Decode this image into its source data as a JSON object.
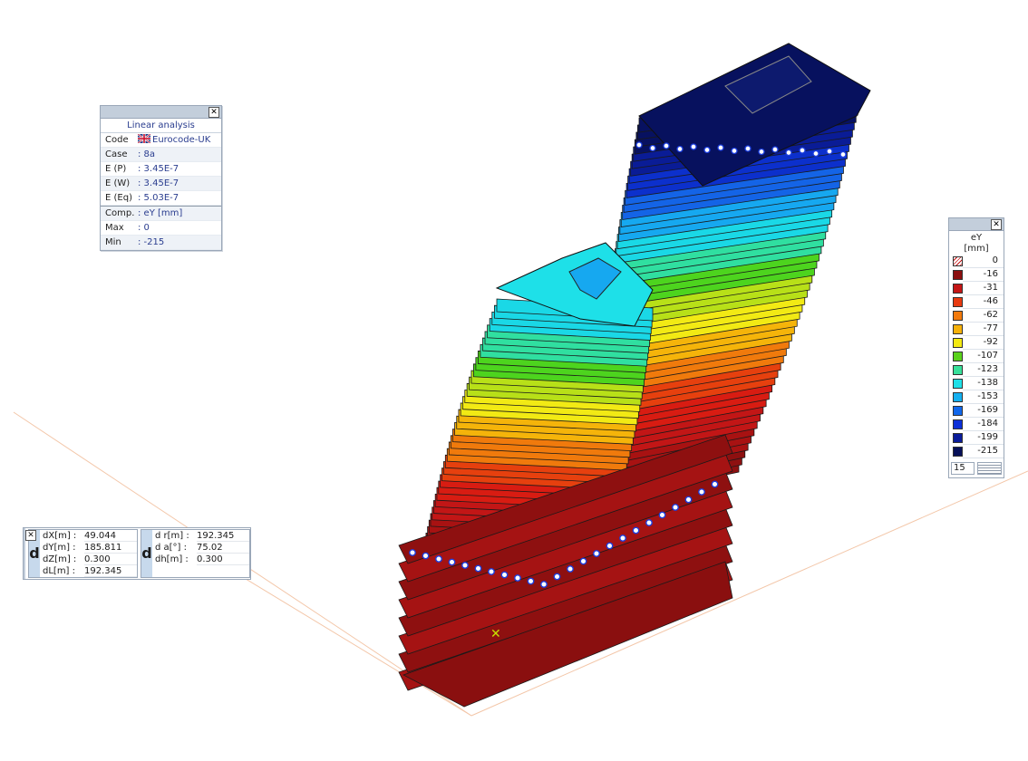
{
  "info_panel": {
    "close_label": "✕",
    "heading": "Linear analysis",
    "rows": [
      {
        "key": "Code",
        "value": "Eurocode-UK"
      },
      {
        "key": "Case",
        "value": ": 8a"
      },
      {
        "key": "E (P)",
        "value": ": 3.45E-7"
      },
      {
        "key": "E (W)",
        "value": ": 3.45E-7"
      },
      {
        "key": "E (Eq)",
        "value": ": 5.03E-7"
      },
      {
        "key": "Comp.",
        "value": ": eY [mm]"
      },
      {
        "key": "Max",
        "value": ": 0"
      },
      {
        "key": "Min",
        "value": ": -215"
      }
    ]
  },
  "legend": {
    "close_label": "✕",
    "title_line1": "eY",
    "title_line2": "[mm]",
    "values": [
      "0",
      "-16",
      "-31",
      "-46",
      "-62",
      "-77",
      "-92",
      "-107",
      "-123",
      "-138",
      "-153",
      "-169",
      "-184",
      "-199",
      "-215"
    ],
    "colors": [
      "#ffffff",
      "#8b0f0f",
      "#c41616",
      "#e83a10",
      "#f27a0c",
      "#f6b10a",
      "#f4ea12",
      "#5ad21c",
      "#38e09a",
      "#1ee0e8",
      "#14b0f0",
      "#1267ea",
      "#0c2fd8",
      "#0a1c9a",
      "#071058"
    ],
    "count": "15"
  },
  "measure": {
    "close_label": "✕",
    "d_label": "d",
    "left": [
      {
        "key": "dX[m] :",
        "value": "49.044"
      },
      {
        "key": "dY[m] :",
        "value": "185.811"
      },
      {
        "key": "dZ[m] :",
        "value": "0.300"
      },
      {
        "key": "dL[m] :",
        "value": "192.345"
      }
    ],
    "right": [
      {
        "key": "d r[m] :",
        "value": "192.345"
      },
      {
        "key": "d a[°] :",
        "value": "75.02"
      },
      {
        "key": "dh[m] :",
        "value": "0.300"
      }
    ]
  },
  "model": {
    "band_colors": [
      "#8e1010",
      "#a81212",
      "#c21616",
      "#d81c12",
      "#e6400e",
      "#f07a0c",
      "#f5b40a",
      "#f2ea14",
      "#b8e018",
      "#4dd41e",
      "#30dfa0",
      "#1ad8e6",
      "#16a8f0",
      "#1464e6",
      "#0c30cc",
      "#0a1c96",
      "#071160"
    ]
  }
}
